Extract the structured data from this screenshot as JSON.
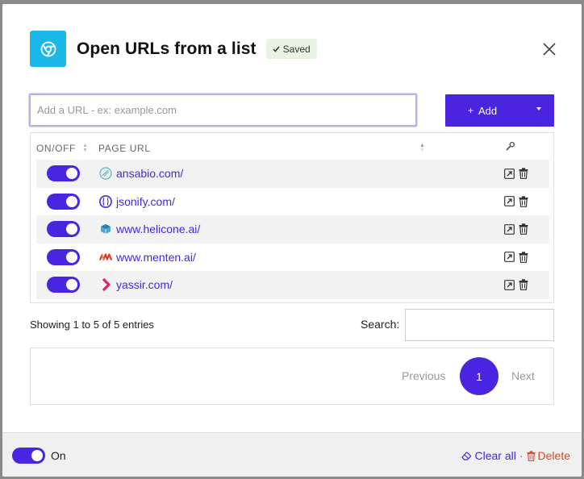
{
  "header": {
    "title": "Open URLs from a list",
    "saved_label": "Saved"
  },
  "url_input": {
    "placeholder": "Add a URL - ex: example.com",
    "value": ""
  },
  "add_button": {
    "label": "Add"
  },
  "table": {
    "columns": [
      "ON/OFF",
      "PAGE URL"
    ],
    "rows": [
      {
        "on": true,
        "url": "ansabio.com/",
        "favicon": "ansabio-favicon-icon"
      },
      {
        "on": true,
        "url": "jsonify.com/",
        "favicon": "jsonify-favicon-icon"
      },
      {
        "on": true,
        "url": "www.helicone.ai/",
        "favicon": "helicone-favicon-icon"
      },
      {
        "on": true,
        "url": "www.menten.ai/",
        "favicon": "menten-favicon-icon"
      },
      {
        "on": true,
        "url": "yassir.com/",
        "favicon": "yassir-favicon-icon"
      }
    ]
  },
  "info": {
    "showing": "Showing 1 to 5 of 5 entries",
    "search_label": "Search:",
    "search_value": ""
  },
  "pagination": {
    "previous": "Previous",
    "current_page": "1",
    "next": "Next"
  },
  "footer": {
    "toggle_label": "On",
    "toggle_on": true,
    "clear_all": "Clear all",
    "separator": "·",
    "delete": "Delete"
  },
  "colors": {
    "accent": "#4a25e1",
    "app_icon_bg": "#19b8e8",
    "saved_bg": "#e8f3e3",
    "delete": "#d44a2a"
  }
}
